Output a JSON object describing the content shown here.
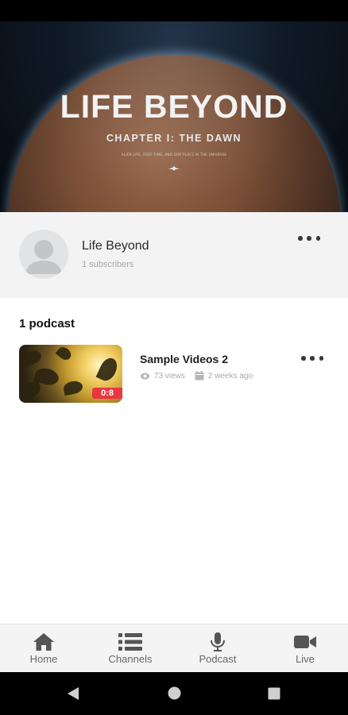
{
  "banner": {
    "title": "LIFE BEYOND",
    "subtitle": "CHAPTER I: THE DAWN",
    "tagline": "ALIEN LIFE, DEEP TIME, AND OUR PLACE IN THE UNIVERSE"
  },
  "channel": {
    "name": "Life Beyond",
    "subscribers": "1 subscribers"
  },
  "podcasts": {
    "count_label": "1 podcast",
    "items": [
      {
        "title": "Sample Videos 2",
        "duration": "0:8",
        "views": "73 views",
        "date": "2 weeks ago"
      }
    ]
  },
  "nav": {
    "items": [
      {
        "label": "Home",
        "icon": "home-icon"
      },
      {
        "label": "Channels",
        "icon": "list-icon"
      },
      {
        "label": "Podcast",
        "icon": "microphone-icon"
      },
      {
        "label": "Live",
        "icon": "video-camera-icon"
      }
    ]
  },
  "colors": {
    "accent_red": "#e8373f",
    "nav_icon": "#555555",
    "channel_card_bg": "#f3f3f3"
  }
}
